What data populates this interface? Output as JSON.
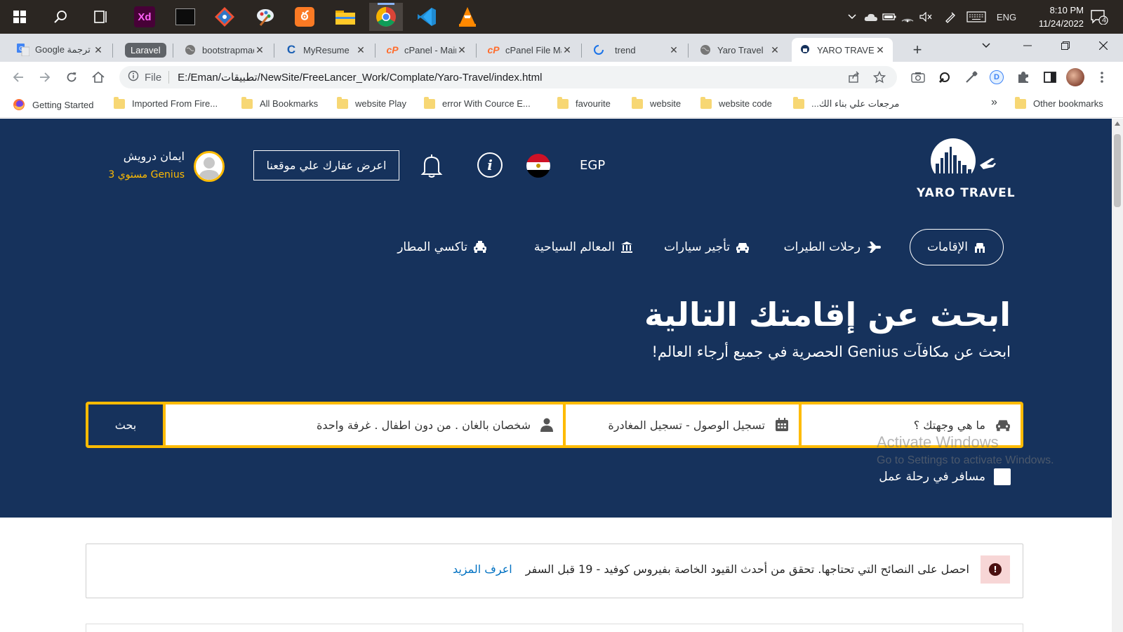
{
  "taskbar": {
    "pinned": [
      {
        "name": "windows-start-icon"
      },
      {
        "name": "search-icon"
      },
      {
        "name": "task-view-icon"
      },
      {
        "name": "adobe-xd-icon",
        "label": "Xd"
      },
      {
        "name": "terminal-icon"
      },
      {
        "name": "git-icon"
      },
      {
        "name": "paint-icon"
      },
      {
        "name": "xampp-icon"
      },
      {
        "name": "file-explorer-icon"
      },
      {
        "name": "chrome-icon"
      },
      {
        "name": "vscode-icon"
      },
      {
        "name": "vlc-icon"
      }
    ],
    "tray_lang": "ENG",
    "time": "8:10 PM",
    "date": "11/24/2022",
    "notifications_count": "4"
  },
  "browser": {
    "tabs": [
      {
        "title": "ترجمة Google",
        "favicon": "google-translate-icon"
      },
      {
        "title": "Laravel",
        "favicon": "laravel-chip"
      },
      {
        "title": "bootstrapmade",
        "favicon": "globe-icon"
      },
      {
        "title": "MyResume",
        "favicon": "c-icon"
      },
      {
        "title": "cPanel - Main",
        "favicon": "cpanel-icon"
      },
      {
        "title": "cPanel File Manager",
        "favicon": "cpanel-icon"
      },
      {
        "title": "trend",
        "favicon": "loading-icon"
      },
      {
        "title": "Yaro Travel",
        "favicon": "globe-icon"
      },
      {
        "title": "YARO TRAVEL",
        "favicon": "yaro-icon",
        "active": true
      }
    ],
    "address": {
      "scheme_label": "File",
      "url": "E:/Eman/تطبيقات/NewSite/FreeLancer_Work/Complate/Yaro-Travel/index.html"
    },
    "bookmarks": [
      {
        "label": "Getting Started",
        "icon": "firefox-icon"
      },
      {
        "label": "Imported From Fire...",
        "icon": "folder-icon"
      },
      {
        "label": "All Bookmarks",
        "icon": "folder-icon"
      },
      {
        "label": "website Play",
        "icon": "folder-icon"
      },
      {
        "label": "error With Cource E...",
        "icon": "folder-icon"
      },
      {
        "label": "favourite",
        "icon": "folder-icon"
      },
      {
        "label": "website",
        "icon": "folder-icon"
      },
      {
        "label": "website code",
        "icon": "folder-icon"
      },
      {
        "label": "مرجعات علي بناء الك...",
        "icon": "folder-icon"
      }
    ],
    "bookmarks_overflow": "»",
    "other_bookmarks": "Other bookmarks"
  },
  "site": {
    "brand": "YARO TRAVEL",
    "currency": "EGP",
    "list_property_label": "اعرض عقارك علي موقعنا",
    "user": {
      "name": "ايمان درويش",
      "level": "Genius مستوي 3"
    },
    "nav": [
      {
        "label": "الإقامات",
        "icon": "hotel-icon",
        "active": true
      },
      {
        "label": "رحلات الطيرات",
        "icon": "plane-icon"
      },
      {
        "label": "تأجير سيارات",
        "icon": "car-icon"
      },
      {
        "label": "المعالم السياحية",
        "icon": "landmark-icon"
      },
      {
        "label": "تاكسي المطار",
        "icon": "taxi-icon"
      }
    ],
    "hero": {
      "title": "ابحث عن إقامتك التالية",
      "subtitle": "ابحث عن مكافآت Genius الحصرية في جميع أرجاء العالم!"
    },
    "search": {
      "destination_placeholder": "ما هي وجهتك ؟",
      "dates_placeholder": "تسجيل الوصول - تسجيل المغادرة",
      "guests_text": "شخصان بالغان . من دون اطفال . غرفة واحدة",
      "button_label": "بحث"
    },
    "business_trip_label": "مسافر في رحلة عمل",
    "notice": {
      "text": "احصل على النصائح التي تحتاجها. تحقق من أحدث القيود الخاصة بفيروس كوفيد - 19 قبل السفر",
      "link": "اعرف المزيد"
    }
  },
  "watermark": {
    "line1": "Activate Windows",
    "line2": "Go to Settings to activate Windows."
  },
  "colors": {
    "hero_bg": "#16325c",
    "accent_yellow": "#febb02",
    "link_blue": "#0071c2"
  }
}
